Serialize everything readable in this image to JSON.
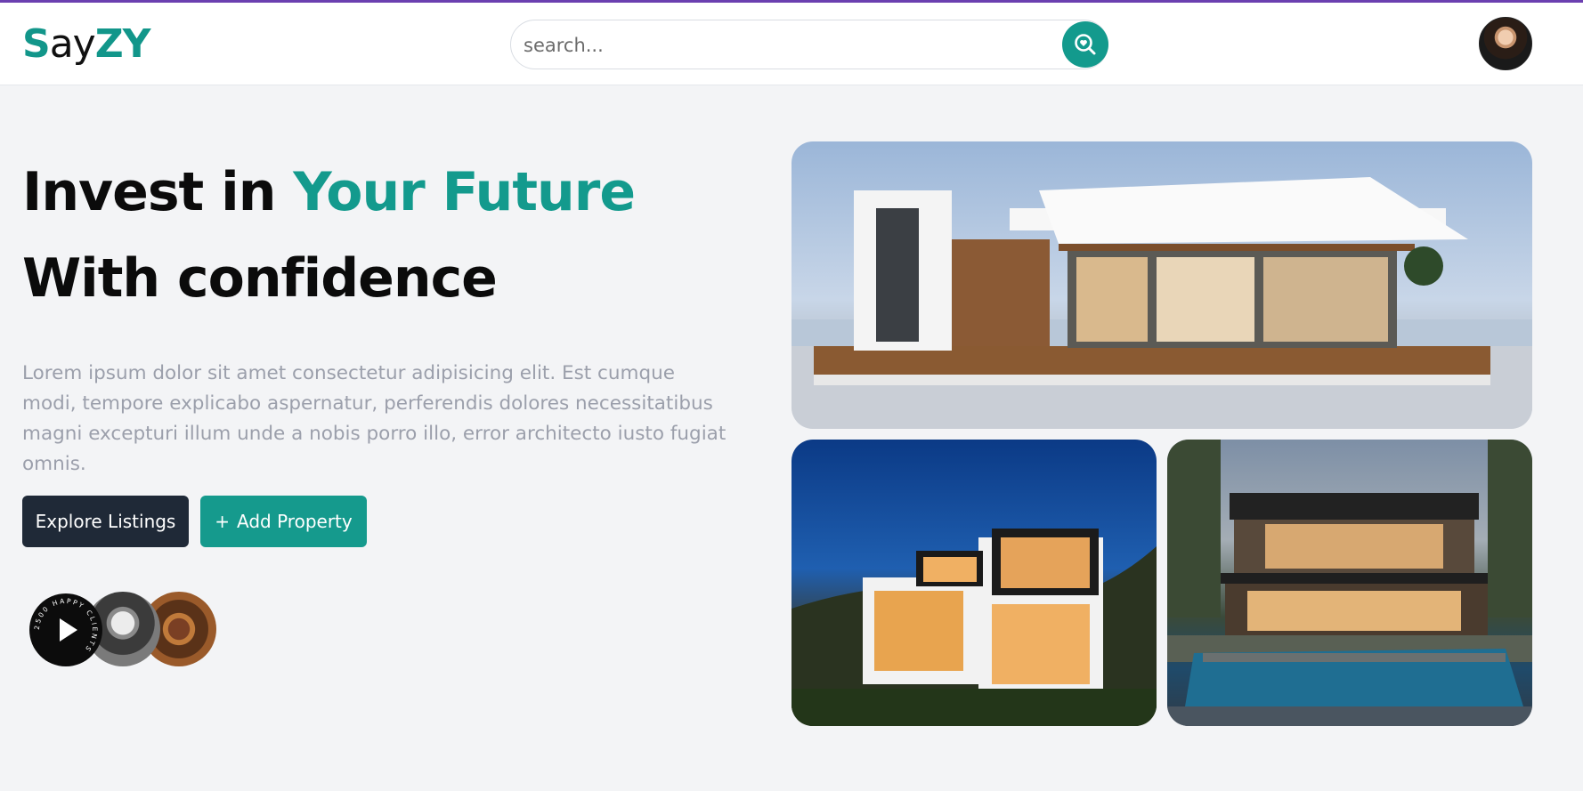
{
  "brand": {
    "logo_part1": "S",
    "logo_part2": "ay",
    "logo_part3": "ZY",
    "accent_color": "#139a8d"
  },
  "search": {
    "placeholder": "search..."
  },
  "hero": {
    "title_part1": "Invest in ",
    "title_accent": "Your Future",
    "title_part2": " With confidence",
    "description": "Lorem ipsum dolor sit amet consectetur adipisicing elit. Est cumque modi, tempore explicabo aspernatur, perferendis dolores necessitatibus magni excepturi illum unde a nobis porro illo, error architecto iusto fugiat omnis."
  },
  "actions": {
    "explore_label": "Explore Listings",
    "add_plus": "+",
    "add_label": "Add Property"
  },
  "clients": {
    "ring_text": "2500 HAPPY CLIENTS"
  },
  "icons": {
    "search_button": "search-heart-icon",
    "play": "play-icon"
  }
}
